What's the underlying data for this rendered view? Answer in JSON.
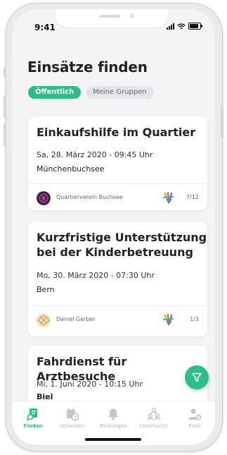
{
  "status_bar": {
    "time": "9:41"
  },
  "header": {
    "title": "Einsätze finden"
  },
  "filters": {
    "public_label": "Öffentlich",
    "groups_label": "Meine Gruppen"
  },
  "cards": [
    {
      "title_line1": "Einkaufshilfe im Quartier",
      "title_line2": "",
      "date": "Sa, 28. März 2020 - 09:45 Uhr",
      "place": "Münchenbuchsee",
      "organizer": "Quartierverein Buchsee",
      "count": "7/12"
    },
    {
      "title_line1": "Kurzfristige Unterstützung",
      "title_line2": "bei der Kinderbetreuung",
      "date": "Mo, 30. März 2020 - 07:30 Uhr",
      "place": "Bern",
      "organizer": "Daniel Gerber",
      "count": "1/3"
    },
    {
      "title_line1": "Fahrdienst für Arztbesuche",
      "title_line2": "",
      "date": "Mi, 1. Juni 2020 - 10:15 Uhr",
      "place": "Biel"
    }
  ],
  "tabs": [
    {
      "label": "Finden",
      "icon": "search-list-icon",
      "active": true
    },
    {
      "label": "Verwalten",
      "icon": "calendar-clock-icon"
    },
    {
      "label": "Meldungen",
      "icon": "bell-icon"
    },
    {
      "label": "Community",
      "icon": "community-icon"
    },
    {
      "label": "Profil",
      "icon": "profile-settings-icon"
    }
  ],
  "colors": {
    "accent": "#2dbd8b",
    "background": "#f4f4f6",
    "inactive_tab": "#b7b7bc"
  },
  "fab": {
    "icon": "filter-icon"
  }
}
